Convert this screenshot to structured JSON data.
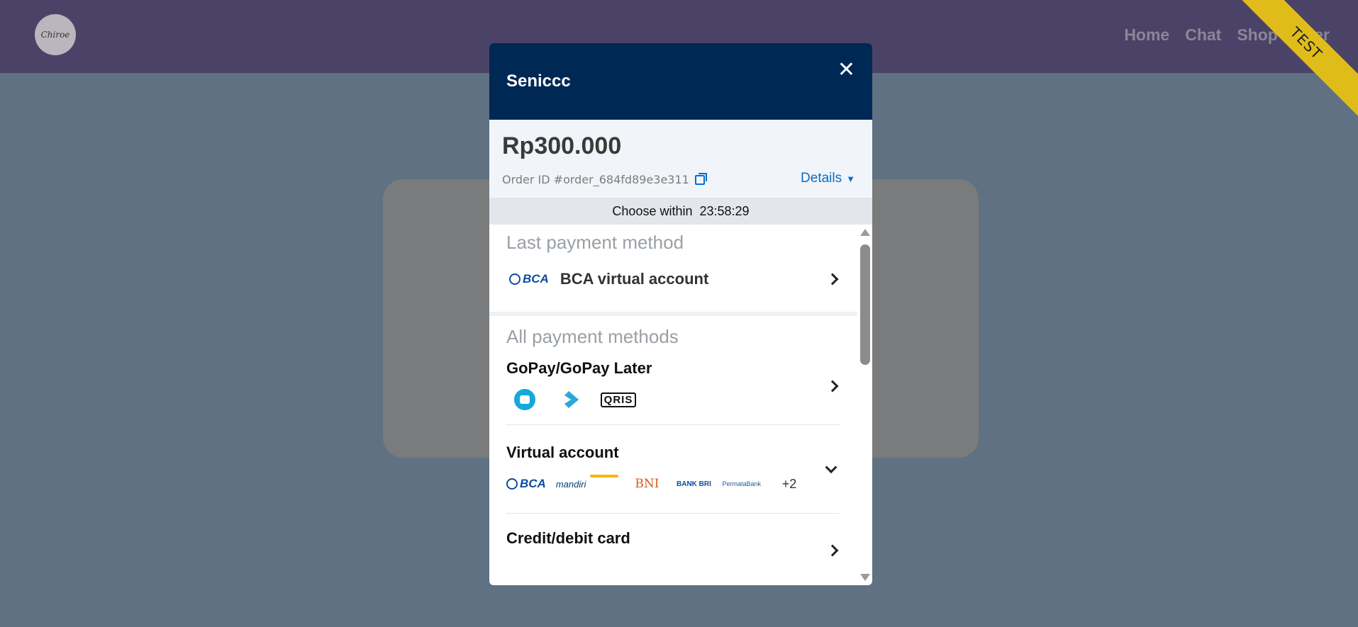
{
  "site": {
    "logo_text": "Chiroe",
    "nav": [
      "Home",
      "Chat",
      "Shop",
      "User"
    ],
    "ribbon": "TEST"
  },
  "modal": {
    "merchant": "Seniccc",
    "close_symbol": "✕",
    "amount": "Rp300.000",
    "order_id": "Order ID #order_684fd89e3e311",
    "details_label": "Details",
    "timer_label": "Choose within",
    "timer_value": "23:58:29",
    "last_section_title": "Last payment method",
    "last_method_label": "BCA virtual account",
    "all_section_title": "All payment methods",
    "methods": [
      {
        "title": "GoPay/GoPay Later"
      },
      {
        "title": "Virtual account",
        "more": "+2"
      },
      {
        "title": "Credit/debit card"
      }
    ],
    "logos": {
      "bca": "BCA",
      "qris": "QRIS",
      "mandiri": "mandiri",
      "bni": "BNI",
      "bri": "BANK BRI",
      "permata": "PermataBank"
    }
  },
  "colors": {
    "header_bg": "#002855",
    "accent_link": "#0b6ec9",
    "site_header": "#4b4267",
    "ribbon": "#e0bc1a"
  }
}
